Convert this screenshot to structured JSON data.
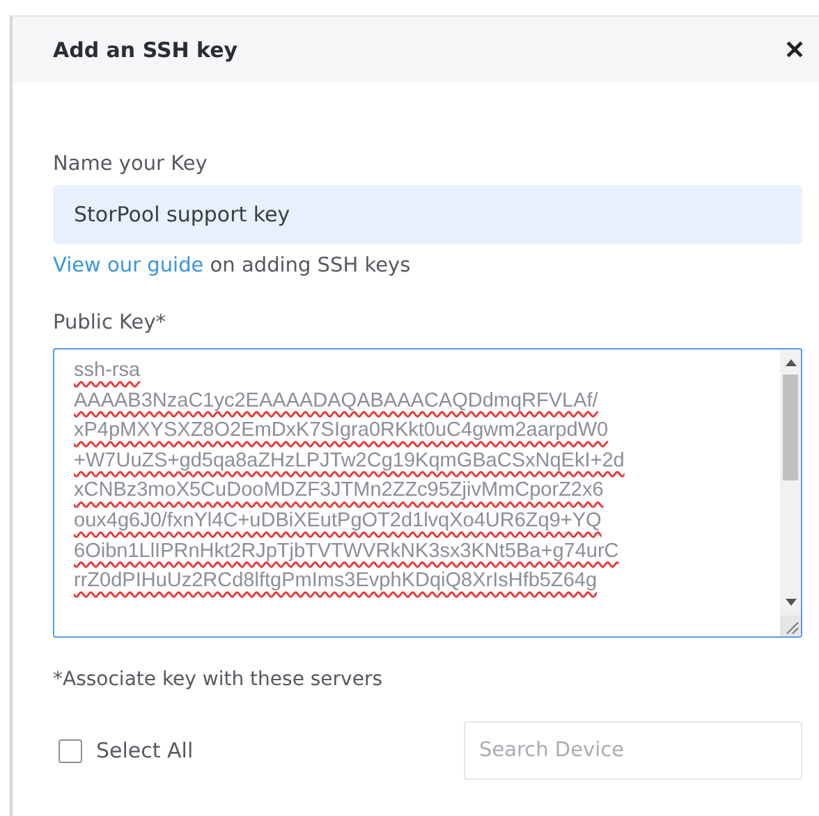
{
  "dialog": {
    "title": "Add an SSH key",
    "close_icon": "✕"
  },
  "name_field": {
    "label": "Name your Key",
    "value": "StorPool support key"
  },
  "guide": {
    "link": "View our guide",
    "text": "on adding SSH keys"
  },
  "public_key": {
    "label": "Public Key*",
    "lines": [
      "ssh-rsa",
      "AAAAB3NzaC1yc2EAAAADAQABAAACAQDdmqRFVLAf/",
      "xP4pMXYSXZ8O2EmDxK7SIgra0RKkt0uC4gwm2aarpdW0",
      "+W7UuZS+gd5qa8aZHzLPJTw2Cg19KqmGBaCSxNqEkI+2d",
      "xCNBz3moX5CuDooMDZF3JTMn2ZZc95ZjivMmCporZ2x6",
      "oux4g6J0/fxnYl4C+uDBiXEutPgOT2d1lvqXo4UR6Zq9+YQ",
      "6Oibn1LlIPRnHkt2RJpTjbTVTWVRkNK3sx3KNt5Ba+g74urC",
      "rrZ0dPIHuUz2RCd8lftgPmIms3EvphKDqiQ8XrIsHfb5Z64g"
    ]
  },
  "servers": {
    "label": "*Associate key with these servers",
    "select_all": {
      "label": "Select All",
      "checked": false
    },
    "search": {
      "placeholder": "Search Device"
    }
  }
}
